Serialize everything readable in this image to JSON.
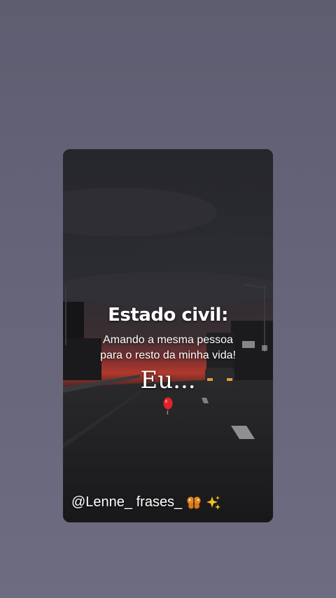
{
  "post": {
    "title": "Estado civil:",
    "subtitle_line1": "Amando a mesma pessoa",
    "subtitle_line2": "para o resto da minha vida!",
    "eu_text": "Eu...",
    "handle": "@Lenne_ frases_"
  },
  "icons": {
    "balloon": "red-balloon-icon",
    "butterfly": "butterfly-icon",
    "sparkles": "sparkles-icon"
  },
  "colors": {
    "background": "#636276",
    "sky_glow": "#c0392b",
    "text": "#ffffff"
  }
}
